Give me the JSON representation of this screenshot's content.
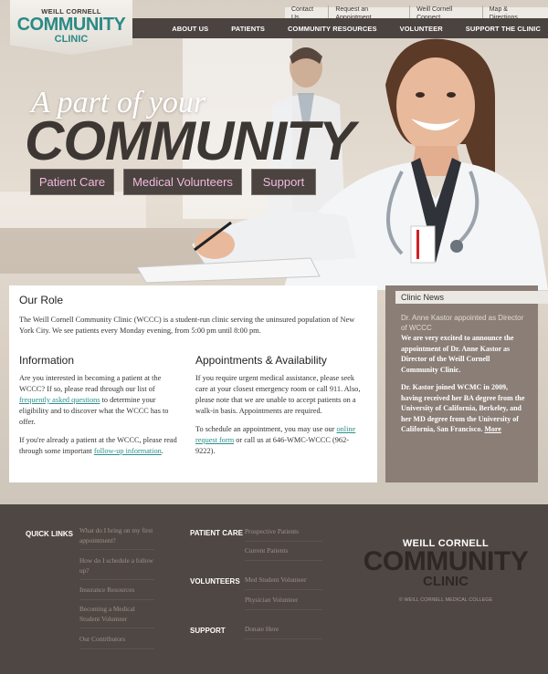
{
  "logo": {
    "line1": "WEILL CORNELL",
    "line2": "COMMUNITY",
    "line3": "CLINIC"
  },
  "utility_nav": [
    "Contact Us",
    "Request an Appointment",
    "Weill Cornell Connect",
    "Map & Directions"
  ],
  "main_nav": [
    "ABOUT US",
    "PATIENTS",
    "COMMUNITY RESOURCES",
    "VOLUNTEER",
    "SUPPORT THE CLINIC"
  ],
  "hero": {
    "tagline": "A part of your",
    "headline": "COMMUNITY",
    "buttons": [
      "Patient Care",
      "Medical Volunteers",
      "Support"
    ]
  },
  "role": {
    "title": "Our Role",
    "text": "The Weill Cornell Community Clinic (WCCC) is a student-run clinic serving the uninsured population of New York City. We see patients every Monday evening, from 5:00 pm until 8:00 pm."
  },
  "information": {
    "title": "Information",
    "p1_pre": "Are you interested in becoming a patient at the WCCC? If so, please read through our list of ",
    "p1_link": "frequently asked questions",
    "p1_post": " to determine your eligibility and to discover what the WCCC has to offer.",
    "p2_pre": "If you're already a patient at the WCCC, please read through some important ",
    "p2_link": "follow-up information",
    "p2_post": "."
  },
  "appointments": {
    "title": "Appointments & Availability",
    "p1": "If you require urgent medical assistance, please seek care at your closest emergency room or call 911. Also, please note that we are unable to accept patients on a walk-in basis. Appointments are required.",
    "p2_pre": "To schedule an appointment, you may use our ",
    "p2_link": "online request form",
    "p2_post": " or call us at 646-WMC-WCCC (962-9222)."
  },
  "news": {
    "title": "Clinic News",
    "item_title": "Dr. Anne Kastor appointed as Director of WCCC",
    "p1": "We are very excited to announce the appointment of Dr. Anne Kastor as Director of the Weill Cornell Community Clinic.",
    "p2": "Dr. Kastor joined WCMC in 2009, having received her BA degree from the University of California, Berkeley, and her MD degree from the University of California, San Francisco.",
    "more": "More"
  },
  "footer": {
    "quick_links_label": "QUICK LINKS",
    "quick_links": [
      "What do I bring on my first appointment?",
      "How do I schedule a follow up?",
      "Insurance Resources",
      "Becoming a Medical Student Volunteer",
      "Our Contributors"
    ],
    "patient_care_label": "PATIENT CARE",
    "patient_care": [
      "Prospective Patients",
      "Current Patients"
    ],
    "volunteers_label": "VOLUNTEERS",
    "volunteers": [
      "Med Student Volunteer",
      "Physician Volunteer"
    ],
    "support_label": "SUPPORT",
    "support": [
      "Donate Here"
    ],
    "logo_line1": "WEILL CORNELL",
    "logo_line2": "COMMUNITY",
    "logo_line3": "CLINIC",
    "copyright": "© WEILL CORNELL MEDICAL COLLEGE"
  },
  "colors": {
    "teal": "#2c8a86",
    "dark": "#4a4340",
    "pink": "#f2b9dc",
    "news_bg": "#8a7e77"
  }
}
